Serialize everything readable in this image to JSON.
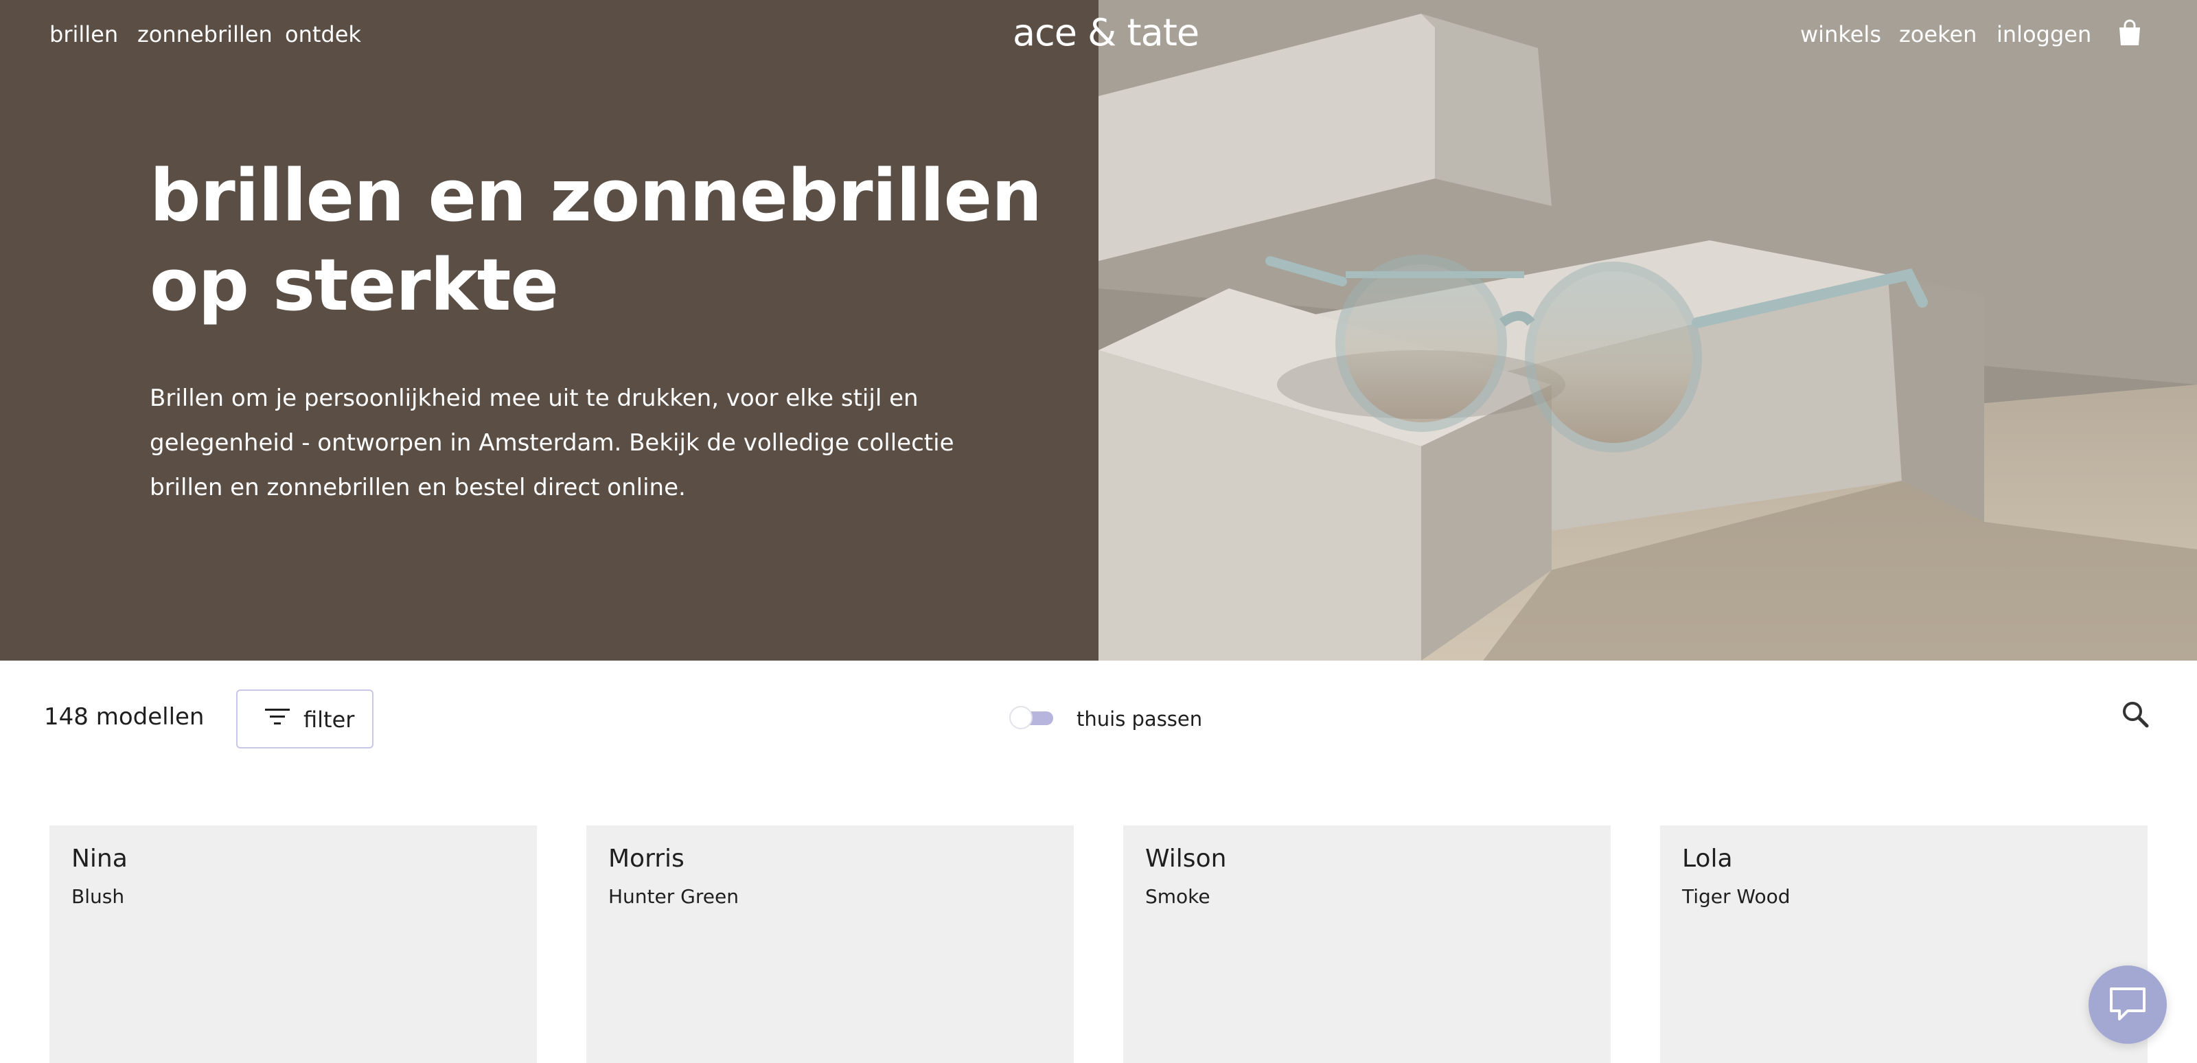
{
  "nav": {
    "left": [
      "brillen",
      "zonnebrillen",
      "ontdek"
    ],
    "logo": "ace & tate",
    "right": [
      "winkels",
      "zoeken",
      "inloggen"
    ],
    "cart_icon": "shopping-bag-icon"
  },
  "hero": {
    "title_line1": "brillen en zonnebrillen",
    "title_line2": "op sterkte",
    "description": "Brillen om je persoonlijkheid mee uit te drukken, voor elke stijl en gelegenheid - ontworpen in Amsterdam. Bekijk de volledige collectie brillen en zonnebrillen en bestel direct online."
  },
  "toolbar": {
    "count": "148 modellen",
    "filter_label": "filter",
    "toggle_label": "thuis passen",
    "toggle_on": false,
    "search_icon": "search-icon"
  },
  "products": [
    {
      "name": "Nina",
      "color": "Blush"
    },
    {
      "name": "Morris",
      "color": "Hunter Green"
    },
    {
      "name": "Wilson",
      "color": "Smoke"
    },
    {
      "name": "Lola",
      "color": "Tiger Wood"
    }
  ],
  "chat_icon": "chat-icon",
  "colors": {
    "hero_bg": "#5a4e45",
    "card_bg": "#efefef",
    "accent": "#b7b5dd",
    "chat_bg": "#a3a8d2"
  }
}
